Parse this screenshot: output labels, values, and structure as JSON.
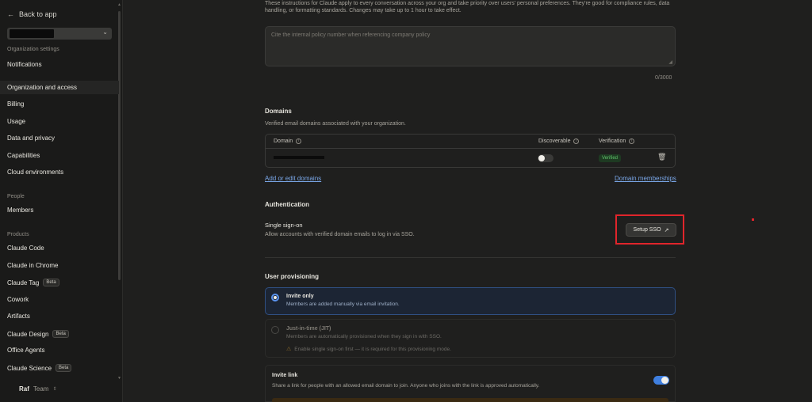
{
  "sidebar": {
    "back_label": "Back to app",
    "sections": {
      "org_settings": "Organization settings",
      "people": "People",
      "products": "Products"
    },
    "items": {
      "notifications": "Notifications",
      "org_access": "Organization and access",
      "billing": "Billing",
      "usage": "Usage",
      "data_privacy": "Data and privacy",
      "capabilities": "Capabilities",
      "cloud_env": "Cloud environments",
      "members": "Members",
      "claude_code": "Claude Code",
      "claude_chrome": "Claude in Chrome",
      "claude_tag": "Claude Tag",
      "cowork": "Cowork",
      "artifacts": "Artifacts",
      "claude_design": "Claude Design",
      "office_agents": "Office Agents",
      "claude_science": "Claude Science"
    },
    "beta_label": "Beta",
    "user": {
      "name": "Raf",
      "plan": "Team"
    }
  },
  "instructions": {
    "description": "These instructions for Claude apply to every conversation across your org and take priority over users' personal preferences. They're good for compliance rules, data handling, or formatting standards. Changes may take up to 1 hour to take effect.",
    "placeholder": "Cite the internal policy number when referencing company policy",
    "counter": "0/3000"
  },
  "domains": {
    "title": "Domains",
    "subtitle": "Verified email domains associated with your organization.",
    "columns": {
      "domain": "Domain",
      "discoverable": "Discoverable",
      "verification": "Verification"
    },
    "row": {
      "status": "Verified",
      "discoverable": false
    },
    "add_link": "Add or edit domains",
    "memberships_link": "Domain memberships"
  },
  "authentication": {
    "title": "Authentication",
    "sso_title": "Single sign-on",
    "sso_desc": "Allow accounts with verified domain emails to log in via SSO.",
    "sso_button": "Setup SSO"
  },
  "provisioning": {
    "title": "User provisioning",
    "options": [
      {
        "title": "Invite only",
        "desc": "Members are added manually via email invitation.",
        "selected": true
      },
      {
        "title": "Just-in-time (JIT)",
        "desc": "Members are automatically provisioned when they sign in with SSO.",
        "warning": "Enable single sign-on first — it is required for this provisioning mode.",
        "selected": false
      }
    ]
  },
  "invite_link": {
    "title": "Invite link",
    "desc": "Share a link for people with an allowed email domain to join. Anyone who joins with the link is approved automatically.",
    "enabled": true
  },
  "colors": {
    "accent": "#3f7fe0",
    "highlight": "#e0252b",
    "verified": "#5fc36a"
  }
}
